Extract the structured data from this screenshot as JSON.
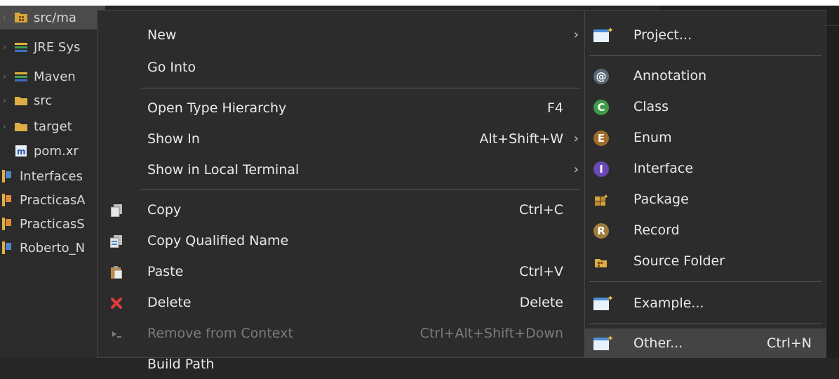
{
  "explorer": {
    "items": [
      {
        "label": "src/ma",
        "icon": "package-folder-icon"
      },
      {
        "label": "JRE Sys",
        "icon": "library-icon"
      },
      {
        "label": "Maven",
        "icon": "library-icon"
      },
      {
        "label": "src",
        "icon": "folder-icon"
      },
      {
        "label": "target",
        "icon": "folder-icon"
      },
      {
        "label": "pom.xr",
        "icon": "maven-file-icon"
      },
      {
        "label": "Interfaces",
        "icon": "project-icon"
      },
      {
        "label": "PracticasA",
        "icon": "project-icon"
      },
      {
        "label": "PracticasS",
        "icon": "project-icon"
      },
      {
        "label": "Roberto_N",
        "icon": "project-icon"
      }
    ]
  },
  "context_menu": {
    "items": [
      {
        "label": "New",
        "shortcut": "",
        "has_submenu": true
      },
      {
        "label": "Go Into",
        "shortcut": ""
      },
      {
        "label": "Open Type Hierarchy",
        "shortcut": "F4"
      },
      {
        "label": "Show In",
        "shortcut": "Alt+Shift+W",
        "has_submenu": true
      },
      {
        "label": "Show in Local Terminal",
        "shortcut": "",
        "has_submenu": true
      },
      {
        "label": "Copy",
        "shortcut": "Ctrl+C",
        "icon": "copy-icon"
      },
      {
        "label": "Copy Qualified Name",
        "shortcut": "",
        "icon": "copy-qualified-name-icon"
      },
      {
        "label": "Paste",
        "shortcut": "Ctrl+V",
        "icon": "paste-icon"
      },
      {
        "label": "Delete",
        "shortcut": "Delete",
        "icon": "delete-icon"
      },
      {
        "label": "Remove from Context",
        "shortcut": "Ctrl+Alt+Shift+Down",
        "icon": "remove-context-icon",
        "disabled": true
      },
      {
        "label": "Build Path",
        "shortcut": ""
      }
    ],
    "chevron": "›"
  },
  "submenu": {
    "items": [
      {
        "label": "Project...",
        "shortcut": "",
        "icon": "new-project-icon"
      },
      {
        "label": "Annotation",
        "shortcut": "",
        "icon": "annotation-icon"
      },
      {
        "label": "Class",
        "shortcut": "",
        "icon": "class-icon"
      },
      {
        "label": "Enum",
        "shortcut": "",
        "icon": "enum-icon"
      },
      {
        "label": "Interface",
        "shortcut": "",
        "icon": "interface-icon"
      },
      {
        "label": "Package",
        "shortcut": "",
        "icon": "package-icon"
      },
      {
        "label": "Record",
        "shortcut": "",
        "icon": "record-icon"
      },
      {
        "label": "Source Folder",
        "shortcut": "",
        "icon": "source-folder-icon"
      },
      {
        "label": "Example...",
        "shortcut": "",
        "icon": "example-icon"
      },
      {
        "label": "Other...",
        "shortcut": "Ctrl+N",
        "icon": "other-icon",
        "hovered": true
      }
    ]
  },
  "colors": {
    "menu_bg": "#2c2c2c",
    "hover_bg": "#444444",
    "class_green": "#3f9a4a",
    "enum_brown": "#a36b2a",
    "interface_purple": "#6a48b8",
    "delete_red": "#e03c3c"
  }
}
